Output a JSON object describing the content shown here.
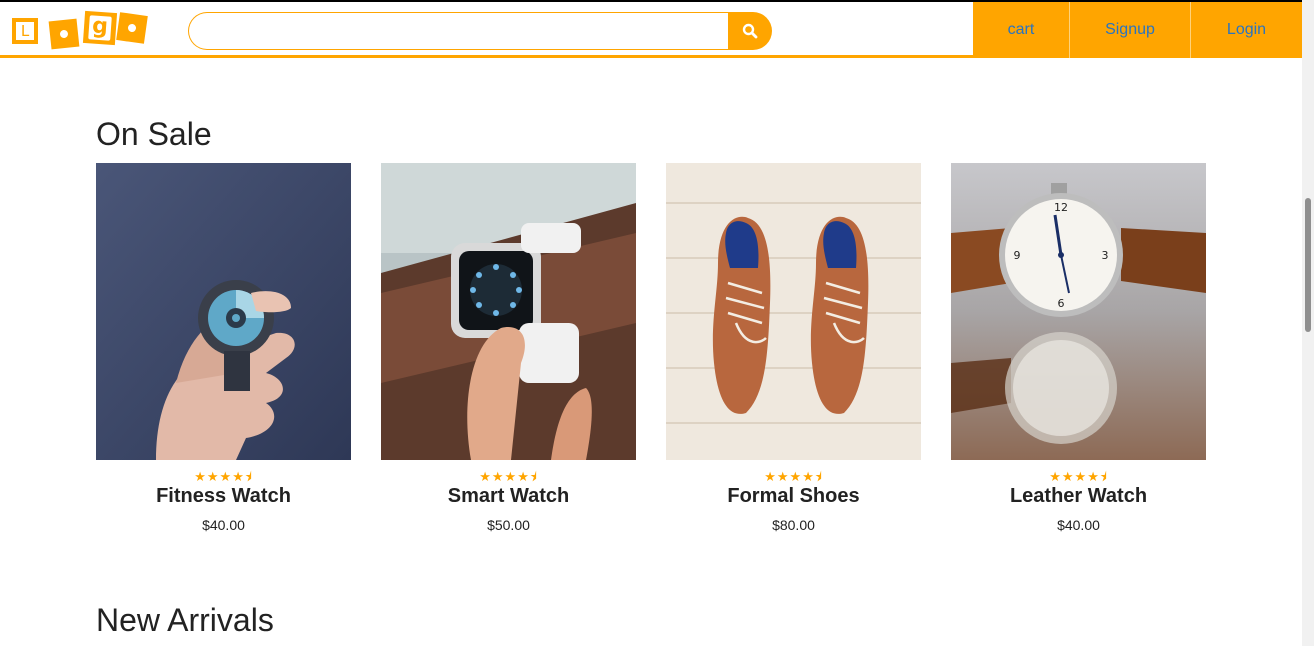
{
  "brand": {
    "logo_letters": [
      "L",
      "o",
      "g",
      "o"
    ]
  },
  "search": {
    "value": "",
    "placeholder": "",
    "icon": "search-icon"
  },
  "nav": {
    "cart": "cart",
    "signup": "Signup",
    "login": "Login"
  },
  "colors": {
    "accent": "#ffa500",
    "nav_link": "#2a74c0"
  },
  "sections": {
    "on_sale": "On Sale",
    "new_arrivals": "New Arrivals"
  },
  "products": [
    {
      "name": "Fitness Watch",
      "price": "$40.00",
      "rating": 4.5,
      "image": "fitness-watch-photo"
    },
    {
      "name": "Smart Watch",
      "price": "$50.00",
      "rating": 4.5,
      "image": "smart-watch-photo"
    },
    {
      "name": "Formal Shoes",
      "price": "$80.00",
      "rating": 4.5,
      "image": "formal-shoes-photo"
    },
    {
      "name": "Leather Watch",
      "price": "$40.00",
      "rating": 4.5,
      "image": "leather-watch-photo"
    }
  ]
}
